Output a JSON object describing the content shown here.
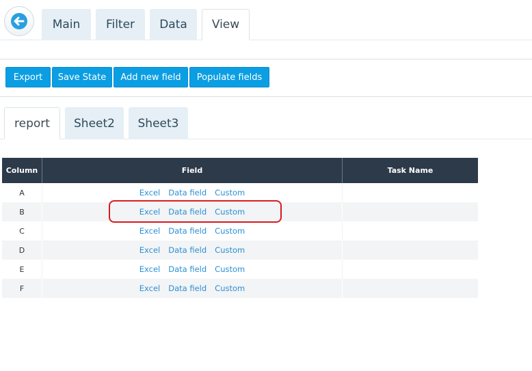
{
  "top_tabs": [
    {
      "label": "Main"
    },
    {
      "label": "Filter"
    },
    {
      "label": "Data"
    },
    {
      "label": "View"
    }
  ],
  "toolbar": {
    "buttons": [
      {
        "label": "Export"
      },
      {
        "label": "Save State"
      },
      {
        "label": "Add new field"
      },
      {
        "label": "Populate fields"
      }
    ]
  },
  "sheet_tabs": [
    {
      "label": "report"
    },
    {
      "label": "Sheet2"
    },
    {
      "label": "Sheet3"
    }
  ],
  "grid": {
    "headers": {
      "column": "Column",
      "field": "Field",
      "task": "Task Name"
    },
    "link_labels": {
      "excel": "Excel",
      "data_field": "Data field",
      "custom": "Custom"
    },
    "rows": [
      {
        "column": "A",
        "task": ""
      },
      {
        "column": "B",
        "task": ""
      },
      {
        "column": "C",
        "task": ""
      },
      {
        "column": "D",
        "task": ""
      },
      {
        "column": "E",
        "task": ""
      },
      {
        "column": "F",
        "task": ""
      }
    ]
  },
  "colors": {
    "accent": "#0b9ee3",
    "header": "#2c3a4a",
    "link": "#2a8fd6",
    "highlight": "#d9191f"
  }
}
